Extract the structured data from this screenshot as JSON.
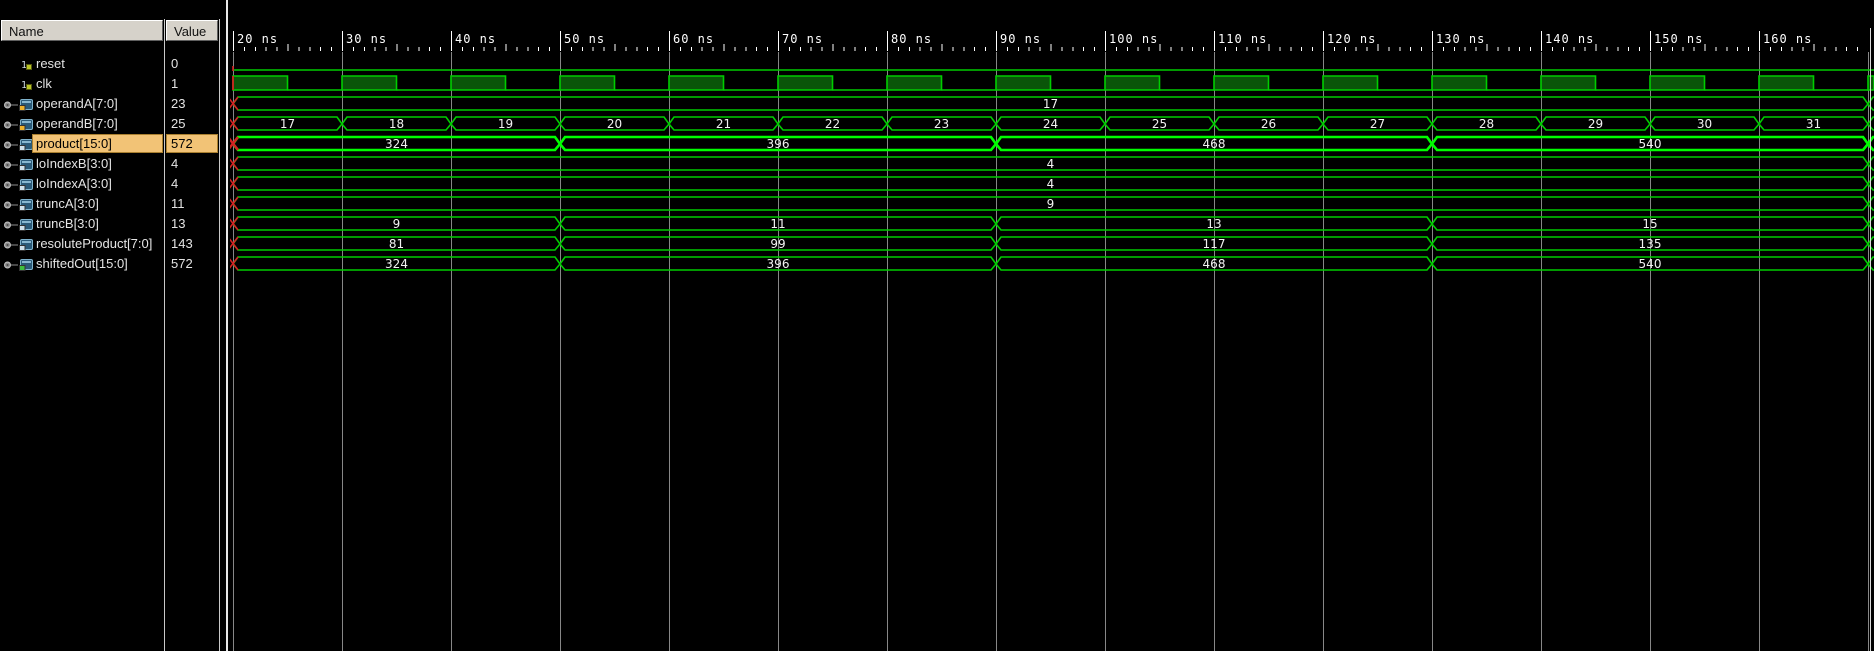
{
  "window": {
    "app": "waveform-viewer"
  },
  "headers": {
    "name": "Name",
    "value": "Value"
  },
  "colors": {
    "background": "#000000",
    "header_bg": "#d6d2ca",
    "panel_text": "#e4e4e4",
    "selection_orange": "#f2c376",
    "wave_green": "#00cd00",
    "wave_selected_green": "#00ff00",
    "clock_fill": "#0a5509",
    "grid_gray": "#878787",
    "edge_marker_red": "#d42222",
    "axis_text": "#ffffff",
    "right_edge_line": "#dcdcdc"
  },
  "timeline": {
    "unit": "ns",
    "start": 20,
    "end": 170.55,
    "major_step": 10,
    "minor_step": 1,
    "ticks": [
      {
        "t": 20,
        "label": "20 ns"
      },
      {
        "t": 30,
        "label": "30 ns"
      },
      {
        "t": 40,
        "label": "40 ns"
      },
      {
        "t": 50,
        "label": "50 ns"
      },
      {
        "t": 60,
        "label": "60 ns"
      },
      {
        "t": 70,
        "label": "70 ns"
      },
      {
        "t": 80,
        "label": "80 ns"
      },
      {
        "t": 90,
        "label": "90 ns"
      },
      {
        "t": 100,
        "label": "100 ns"
      },
      {
        "t": 110,
        "label": "110 ns"
      },
      {
        "t": 120,
        "label": "120 ns"
      },
      {
        "t": 130,
        "label": "130 ns"
      },
      {
        "t": 140,
        "label": "140 ns"
      },
      {
        "t": 150,
        "label": "150 ns"
      },
      {
        "t": 160,
        "label": "160 ns"
      }
    ]
  },
  "signals": [
    {
      "name": "reset",
      "value": "0",
      "type": "scalar",
      "level": "low",
      "icon": "scalar"
    },
    {
      "name": "clk",
      "value": "1",
      "type": "clock",
      "first_edge": 20,
      "period": 10,
      "high_time": 5,
      "icon": "scalar"
    },
    {
      "name": "operandA[7:0]",
      "value": "23",
      "type": "bus",
      "icon": "bus",
      "badge": "#eeb22c",
      "segments": [
        [
          20,
          170,
          "17"
        ],
        [
          170,
          null,
          ""
        ]
      ]
    },
    {
      "name": "operandB[7:0]",
      "value": "25",
      "type": "bus",
      "icon": "bus",
      "badge": "#eeb22c",
      "segments": [
        [
          20,
          30,
          "17"
        ],
        [
          30,
          40,
          "18"
        ],
        [
          40,
          50,
          "19"
        ],
        [
          50,
          60,
          "20"
        ],
        [
          60,
          70,
          "21"
        ],
        [
          70,
          80,
          "22"
        ],
        [
          80,
          90,
          "23"
        ],
        [
          90,
          100,
          "24"
        ],
        [
          100,
          110,
          "25"
        ],
        [
          110,
          120,
          "26"
        ],
        [
          120,
          130,
          "27"
        ],
        [
          130,
          140,
          "28"
        ],
        [
          140,
          150,
          "29"
        ],
        [
          150,
          160,
          "30"
        ],
        [
          160,
          170,
          "31"
        ],
        [
          170,
          null,
          ""
        ]
      ]
    },
    {
      "name": "product[15:0]",
      "value": "572",
      "type": "bus",
      "selected": true,
      "icon": "bus",
      "badge": "#cfe0ea",
      "segments": [
        [
          20,
          50,
          "324"
        ],
        [
          50,
          90,
          "396"
        ],
        [
          90,
          130,
          "468"
        ],
        [
          130,
          170,
          "540"
        ],
        [
          170,
          null,
          ""
        ]
      ]
    },
    {
      "name": "loIndexB[3:0]",
      "value": "4",
      "type": "bus",
      "icon": "bus",
      "badge": "#cfe0ea",
      "segments": [
        [
          20,
          170,
          "4"
        ],
        [
          170,
          null,
          ""
        ]
      ]
    },
    {
      "name": "loIndexA[3:0]",
      "value": "4",
      "type": "bus",
      "icon": "bus",
      "badge": "#cfe0ea",
      "segments": [
        [
          20,
          170,
          "4"
        ],
        [
          170,
          null,
          ""
        ]
      ]
    },
    {
      "name": "truncA[3:0]",
      "value": "11",
      "type": "bus",
      "icon": "bus",
      "badge": "#cfe0ea",
      "segments": [
        [
          20,
          170,
          "9"
        ],
        [
          170,
          null,
          ""
        ]
      ]
    },
    {
      "name": "truncB[3:0]",
      "value": "13",
      "type": "bus",
      "icon": "bus",
      "badge": "#cfe0ea",
      "segments": [
        [
          20,
          50,
          "9"
        ],
        [
          50,
          90,
          "11"
        ],
        [
          90,
          130,
          "13"
        ],
        [
          130,
          170,
          "15"
        ],
        [
          170,
          null,
          ""
        ]
      ]
    },
    {
      "name": "resoluteProduct[7:0]",
      "value": "143",
      "type": "bus",
      "icon": "bus",
      "badge": "#cfe0ea",
      "segments": [
        [
          20,
          50,
          "81"
        ],
        [
          50,
          90,
          "99"
        ],
        [
          90,
          130,
          "117"
        ],
        [
          130,
          170,
          "135"
        ],
        [
          170,
          null,
          ""
        ]
      ]
    },
    {
      "name": "shiftedOut[15:0]",
      "value": "572",
      "type": "bus",
      "icon": "bus",
      "badge": "#3fbf3f",
      "segments": [
        [
          20,
          50,
          "324"
        ],
        [
          50,
          90,
          "396"
        ],
        [
          90,
          130,
          "468"
        ],
        [
          130,
          170,
          "540"
        ],
        [
          170,
          null,
          ""
        ]
      ]
    }
  ]
}
